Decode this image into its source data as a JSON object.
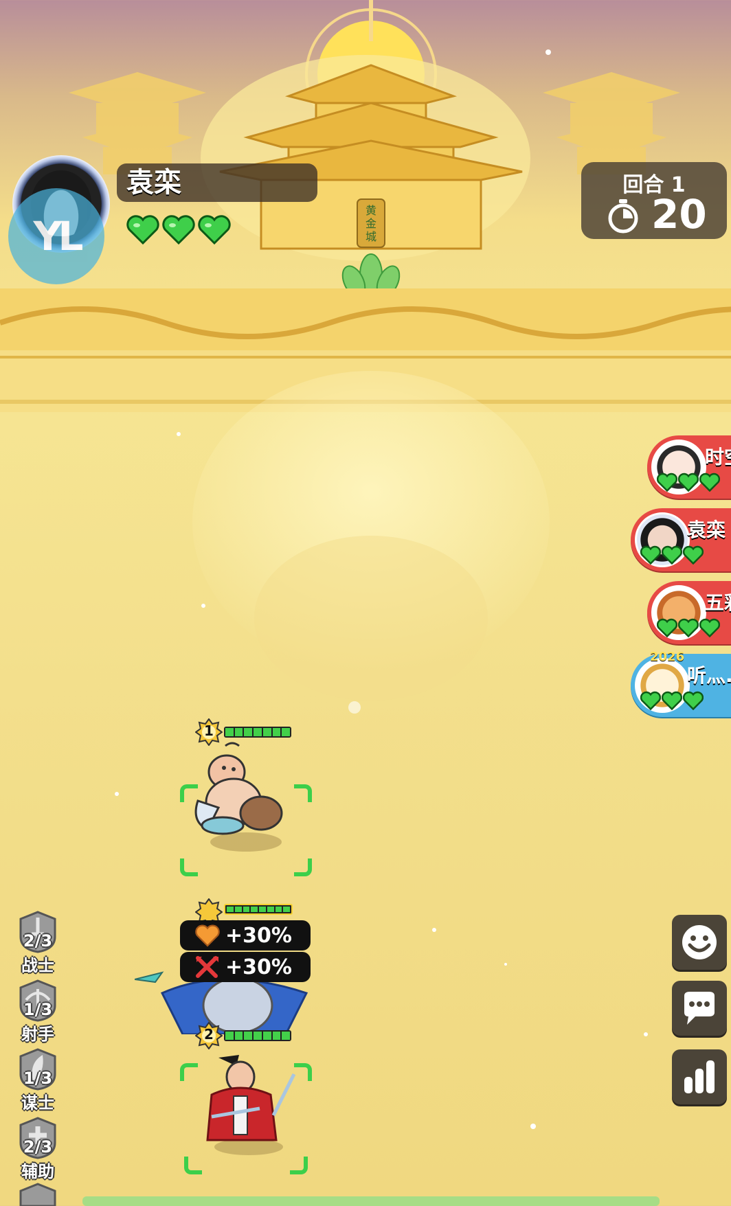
{
  "player": {
    "name": "袁栾",
    "lives": 3,
    "badge_text": "YL"
  },
  "round": {
    "label": "回合 1",
    "timer": "20"
  },
  "opponents": [
    {
      "name": "时空",
      "lives": 3,
      "style": "red"
    },
    {
      "name": "袁栾",
      "lives": 3,
      "style": "red"
    },
    {
      "name": "五彩",
      "lives": 3,
      "style": "red"
    },
    {
      "name": "听灬..",
      "lives": 3,
      "style": "blue",
      "tag": "2026"
    }
  ],
  "board": {
    "units": [
      {
        "level": "1",
        "hp": 1.0
      },
      {
        "level": "2",
        "hp": 1.0
      },
      {
        "level": "",
        "hp": 1.0,
        "buffs": [
          {
            "icon": "heart-icon",
            "text": "+30%"
          },
          {
            "icon": "attack-icon",
            "text": "+30%"
          }
        ]
      }
    ],
    "palace_sign": "黄金城"
  },
  "classes": [
    {
      "count": "2/3",
      "label": "战士",
      "icon": "sword-icon"
    },
    {
      "count": "1/3",
      "label": "射手",
      "icon": "bow-icon"
    },
    {
      "count": "1/3",
      "label": "谋士",
      "icon": "feather-icon"
    },
    {
      "count": "2/3",
      "label": "辅助",
      "icon": "cross-icon"
    }
  ],
  "actions": [
    {
      "icon": "emoji-icon"
    },
    {
      "icon": "chat-icon"
    },
    {
      "icon": "stats-icon"
    }
  ],
  "colors": {
    "heart": "#3fcf4a",
    "opponent_red": "#e74a45",
    "opponent_blue": "#4fb3e3",
    "hp_green": "#43d04a"
  }
}
